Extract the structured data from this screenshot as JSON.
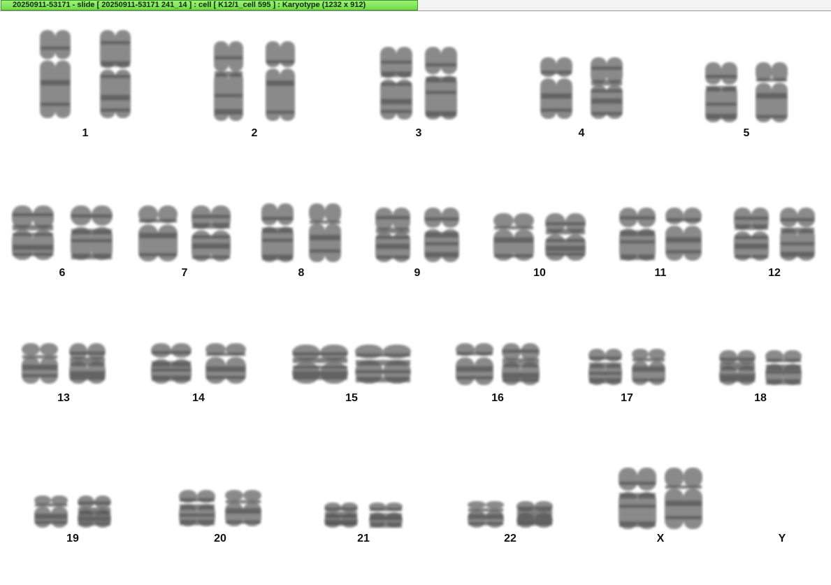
{
  "window": {
    "title": "20250911-53171 - slide [ 20250911-53171 241_14 ] : cell [ K12/1_cell 595 ] : Karyotype  (1232 x 912)"
  },
  "karyotype": {
    "pairs": [
      {
        "label": "1",
        "count": 2
      },
      {
        "label": "2",
        "count": 2
      },
      {
        "label": "3",
        "count": 2
      },
      {
        "label": "4",
        "count": 2
      },
      {
        "label": "5",
        "count": 2
      },
      {
        "label": "6",
        "count": 2
      },
      {
        "label": "7",
        "count": 2
      },
      {
        "label": "8",
        "count": 2
      },
      {
        "label": "9",
        "count": 2
      },
      {
        "label": "10",
        "count": 2
      },
      {
        "label": "11",
        "count": 2
      },
      {
        "label": "12",
        "count": 2
      },
      {
        "label": "13",
        "count": 2
      },
      {
        "label": "14",
        "count": 2
      },
      {
        "label": "15",
        "count": 2
      },
      {
        "label": "16",
        "count": 2
      },
      {
        "label": "17",
        "count": 2
      },
      {
        "label": "18",
        "count": 2
      },
      {
        "label": "19",
        "count": 2
      },
      {
        "label": "20",
        "count": 2
      },
      {
        "label": "21",
        "count": 2
      },
      {
        "label": "22",
        "count": 2
      },
      {
        "label": "X",
        "count": 2
      },
      {
        "label": "Y",
        "count": 0
      }
    ]
  },
  "colors": {
    "title_tab": "#7ee356",
    "chromosome": "#555555",
    "background": "#ffffff"
  }
}
